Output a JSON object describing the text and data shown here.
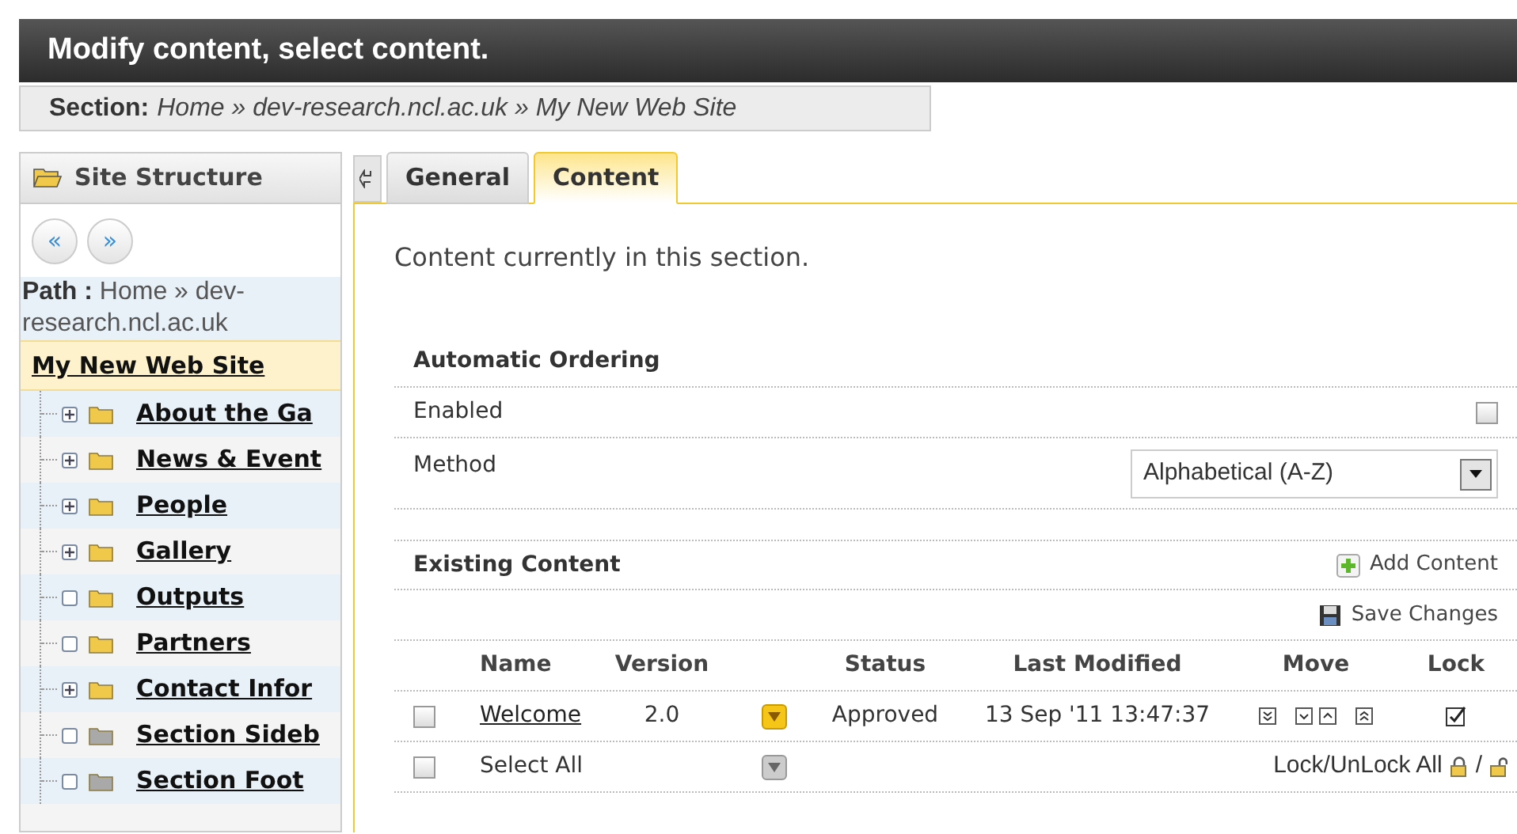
{
  "header": {
    "title": "Modify content, select content."
  },
  "breadcrumb": {
    "label": "Section:",
    "trail": "Home » dev-research.ncl.ac.uk » My New Web Site"
  },
  "sidebar": {
    "title": "Site Structure",
    "back": "«",
    "forward": "»",
    "path_label": "Path :",
    "path": "Home » dev-research.ncl.ac.uk",
    "current": "My New Web Site",
    "items": [
      {
        "label": "About the Ga",
        "expandable": true,
        "kind": "folder"
      },
      {
        "label": "News & Event",
        "expandable": true,
        "kind": "folder"
      },
      {
        "label": "People",
        "expandable": true,
        "kind": "folder"
      },
      {
        "label": "Gallery",
        "expandable": true,
        "kind": "folder"
      },
      {
        "label": "Outputs",
        "expandable": false,
        "kind": "folder"
      },
      {
        "label": "Partners",
        "expandable": false,
        "kind": "folder"
      },
      {
        "label": "Contact Infor",
        "expandable": true,
        "kind": "folder"
      },
      {
        "label": "Section Sideb",
        "expandable": false,
        "kind": "system"
      },
      {
        "label": "Section Foot",
        "expandable": false,
        "kind": "system"
      }
    ]
  },
  "tabs": [
    {
      "label": "General",
      "selected": false
    },
    {
      "label": "Content",
      "selected": true
    }
  ],
  "intro": "Content currently in this section.",
  "ordering": {
    "title": "Automatic Ordering",
    "enabled_label": "Enabled",
    "enabled": false,
    "method_label": "Method",
    "method": "Alphabetical (A-Z)"
  },
  "existing": {
    "title": "Existing Content",
    "add": "Add Content",
    "save": "Save Changes",
    "columns": [
      "Name",
      "Version",
      "Status",
      "Last Modified",
      "Move",
      "Lock"
    ],
    "rows": [
      {
        "checked": false,
        "name": "Welcome",
        "version": "2.0",
        "status": "Approved",
        "modified": "13 Sep '11 13:47:37",
        "locked": true
      }
    ],
    "select_all": "Select All",
    "select_all_checked": false,
    "lock_all": "Lock/UnLock All",
    "lock_sep": "/"
  }
}
